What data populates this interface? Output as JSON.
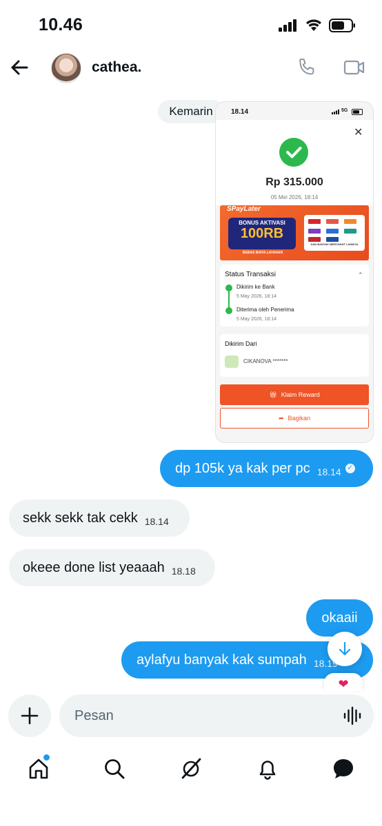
{
  "status_bar": {
    "time": "10.46"
  },
  "header": {
    "contact_name": "cathea."
  },
  "chat": {
    "day_label": "Kemarin",
    "shared_screenshot": {
      "time": "18.14",
      "network": "5G",
      "amount": "Rp 315.000",
      "date": "05 Mei 2026, 18:14",
      "banner": {
        "brand": "SPayLater",
        "line1": "BONUS AKTIVASI",
        "line2": "100RB",
        "line3": "BEBAS BIAYA LAYANAN",
        "merchant_tag": "DAN BANYAK MERCHANT LAINNYA"
      },
      "status_title": "Status Transaksi",
      "steps": [
        {
          "label": "Dikirim ke Bank",
          "time": "5 May 2026, 18:14"
        },
        {
          "label": "Diterima oleh Penerima",
          "time": "5 May 2026, 18:14"
        }
      ],
      "from_title": "Dikirim Dari",
      "from_name": "CIKANOVA *******",
      "claim_label": "Klaim Reward",
      "share_label": "Bagikan"
    },
    "messages": [
      {
        "text": "dp 105k ya kak per pc",
        "time": "18.14",
        "direction": "sent"
      },
      {
        "text": "sekk sekk tak cekk",
        "time": "18.14",
        "direction": "received"
      },
      {
        "text": "okeee done list yeaaah",
        "time": "18.18",
        "direction": "received"
      },
      {
        "text": "okaaii",
        "time": "",
        "direction": "sent"
      },
      {
        "text": "aylafyu banyak kak sumpah",
        "time": "18.19",
        "direction": "sent"
      }
    ],
    "reaction": "❤"
  },
  "composer": {
    "placeholder": "Pesan"
  },
  "colors": {
    "accent": "#1d9bf0",
    "received_bubble": "#eff3f4",
    "shopee_orange": "#ef5326",
    "success_green": "#2db84d"
  }
}
